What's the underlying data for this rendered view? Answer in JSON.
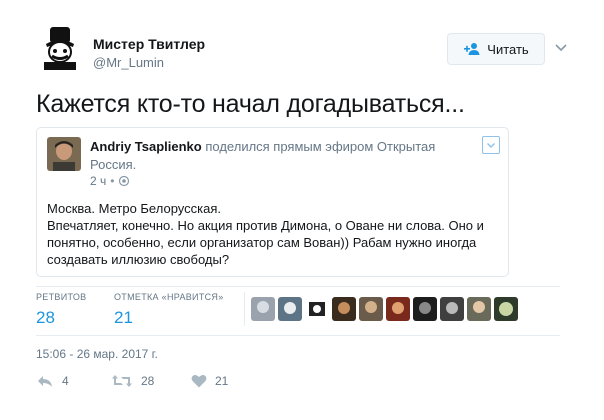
{
  "tweet": {
    "author_name": "Мистер Твитлер",
    "author_handle": "@Mr_Lumin",
    "follow_label": "Читать",
    "text": "Кажется кто-то начал догадываться...",
    "timestamp": "15:06 - 26 мар. 2017 г."
  },
  "quoted": {
    "author_name": "Andriy Tsaplienko",
    "action_text": "поделился прямым эфиром",
    "target": "Открытая Россия.",
    "time": "2 ч",
    "body": [
      "Москва. Метро Белорусская.",
      "Впечатляет, конечно. Но акция против Димона, о Оване ни слова. Оно и понятно, особенно, если организатор сам Вован)) Рабам нужно иногда создавать иллюзию свободы?"
    ]
  },
  "stats": {
    "retweets_label": "РЕТВИТОВ",
    "retweets": "28",
    "likes_label": "ОТМЕТКА «НРАВИТСЯ»",
    "likes": "21"
  },
  "actions": {
    "reply_count": "4",
    "retweet_count": "28",
    "like_count": "21"
  },
  "colors": {
    "accent": "#1b95e0",
    "muted": "#657786",
    "border": "#e1e8ed"
  }
}
